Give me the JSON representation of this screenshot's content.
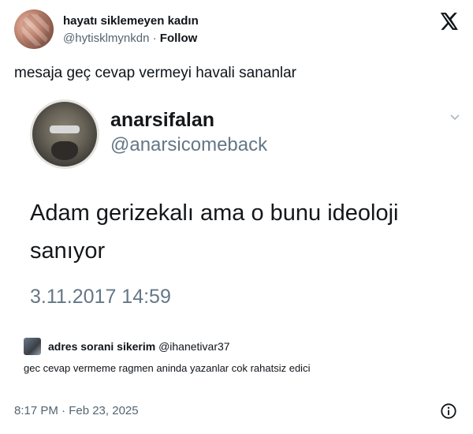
{
  "author": {
    "display_name": "hayatı siklemeyen kadın",
    "handle": "@hytisklmynkdn",
    "separator": "·",
    "follow_label": "Follow"
  },
  "tweet": {
    "text": "mesaja geç cevap vermeyi havali sananlar"
  },
  "quoted": {
    "name": "anarsifalan",
    "handle": "@anarsicomeback",
    "text": "Adam gerizekalı ama o bunu ideoloji sanıyor",
    "timestamp": "3.11.2017 14:59"
  },
  "reply": {
    "name": "adres sorani sikerim",
    "handle": "@ihanetivar37",
    "text": "gec cevap vermeme ragmen aninda yazanlar cok rahatsiz edici"
  },
  "footer": {
    "timestamp": "8:17 PM · Feb 23, 2025"
  },
  "icons": {
    "brand": "x-logo-icon",
    "more": "chevron-down-icon",
    "info": "info-icon"
  },
  "colors": {
    "text": "#0f1419",
    "secondary": "#536471",
    "quote_secondary": "#657786"
  }
}
